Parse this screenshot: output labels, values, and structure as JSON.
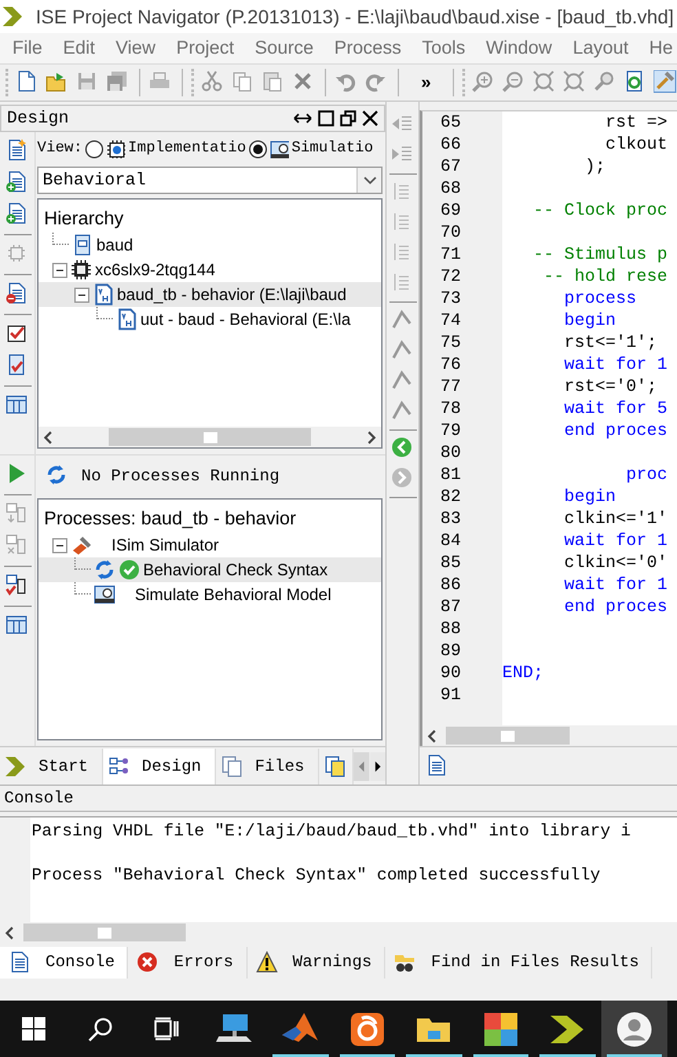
{
  "window": {
    "title": "ISE Project Navigator (P.20131013) - E:\\laji\\baud\\baud.xise - [baud_tb.vhd]"
  },
  "menu": [
    "File",
    "Edit",
    "View",
    "Project",
    "Source",
    "Process",
    "Tools",
    "Window",
    "Layout",
    "He"
  ],
  "toolbar": {
    "overflow": "»"
  },
  "design_panel": {
    "title": "Design",
    "view_label": "View:",
    "view_options": [
      {
        "label": "Implementatio",
        "kind": "implementation",
        "selected": false
      },
      {
        "label": "Simulatio",
        "kind": "simulation",
        "selected": true
      }
    ],
    "dropdown": "Behavioral",
    "hierarchy_title": "Hierarchy",
    "tree": [
      {
        "label": "baud",
        "kind": "project",
        "selected": false
      },
      {
        "label": "xc6slx9-2tqg144",
        "kind": "chip",
        "selected": false,
        "expanded": true,
        "children": [
          {
            "label": "baud_tb - behavior (E:\\laji\\baud",
            "kind": "vhdl",
            "selected": true,
            "expanded": true,
            "children": [
              {
                "label": "uut - baud - Behavioral (E:\\la",
                "kind": "vhdl",
                "selected": false
              }
            ]
          }
        ]
      }
    ]
  },
  "processes_panel": {
    "status": "No Processes Running",
    "title": "Processes: baud_tb - behavior",
    "tree": [
      {
        "label": "ISim Simulator",
        "kind": "tool",
        "selected": false,
        "expanded": true,
        "children": [
          {
            "label": "Behavioral Check Syntax",
            "kind": "check",
            "selected": true
          },
          {
            "label": "Simulate Behavioral Model",
            "kind": "sim",
            "selected": false
          }
        ]
      }
    ]
  },
  "left_tabs": [
    {
      "label": "Start",
      "kind": "start",
      "selected": false
    },
    {
      "label": "Design",
      "kind": "design",
      "selected": true
    },
    {
      "label": "Files",
      "kind": "files",
      "selected": false
    }
  ],
  "editor": {
    "lines": [
      {
        "number": "65",
        "kind": "plain",
        "text": "          rst =>"
      },
      {
        "number": "66",
        "kind": "plain",
        "text": "          clkout"
      },
      {
        "number": "67",
        "kind": "plain",
        "text": "        );"
      },
      {
        "number": "68"
      },
      {
        "number": "69",
        "kind": "comment",
        "text": "   -- Clock proc"
      },
      {
        "number": "70"
      },
      {
        "number": "71",
        "kind": "comment",
        "text": "   -- Stimulus p"
      },
      {
        "number": "72",
        "kind": "comment",
        "text": "    -- hold rese"
      },
      {
        "number": "73",
        "kind": "keyword",
        "text": "      process"
      },
      {
        "number": "74",
        "kind": "keyword",
        "text": "      begin"
      },
      {
        "number": "75",
        "kind": "plain",
        "text": "      rst<='1';"
      },
      {
        "number": "76",
        "kind": "keyword",
        "text": "      wait for 1"
      },
      {
        "number": "77",
        "kind": "plain",
        "text": "      rst<='0';"
      },
      {
        "number": "78",
        "kind": "keyword",
        "text": "      wait for 5"
      },
      {
        "number": "79",
        "kind": "keyword",
        "text": "      end proces"
      },
      {
        "number": "80"
      },
      {
        "number": "81",
        "kind": "keyword",
        "text": "            proc"
      },
      {
        "number": "82",
        "kind": "keyword",
        "text": "      begin"
      },
      {
        "number": "83",
        "kind": "plain",
        "text": "      clkin<='1'"
      },
      {
        "number": "84",
        "kind": "keyword",
        "text": "      wait for 1"
      },
      {
        "number": "85",
        "kind": "plain",
        "text": "      clkin<='0'"
      },
      {
        "number": "86",
        "kind": "keyword",
        "text": "      wait for 1"
      },
      {
        "number": "87",
        "kind": "keyword",
        "text": "      end proces"
      },
      {
        "number": "88"
      },
      {
        "number": "89"
      },
      {
        "number": "90",
        "kind": "keyword",
        "text": "END;"
      },
      {
        "number": "91"
      }
    ]
  },
  "console": {
    "title": "Console",
    "lines": [
      "Parsing VHDL file \"E:/laji/baud/baud_tb.vhd\" into library i",
      "Process \"Behavioral Check Syntax\" completed successfully"
    ],
    "tabs": [
      {
        "label": "Console",
        "kind": "console",
        "selected": true
      },
      {
        "label": "Errors",
        "kind": "errors",
        "selected": false
      },
      {
        "label": "Warnings",
        "kind": "warnings",
        "selected": false
      },
      {
        "label": "Find in Files Results",
        "kind": "find",
        "selected": false
      }
    ]
  },
  "taskbar": {
    "apps": [
      {
        "kind": "computer",
        "running": false,
        "selected": false
      },
      {
        "kind": "matlab",
        "running": true,
        "selected": false
      },
      {
        "kind": "browser",
        "running": true,
        "selected": false
      },
      {
        "kind": "folder",
        "running": true,
        "selected": false
      },
      {
        "kind": "pdf",
        "running": true,
        "selected": false
      },
      {
        "kind": "ise",
        "running": true,
        "selected": false
      },
      {
        "kind": "avatar",
        "running": true,
        "selected": true
      }
    ]
  }
}
